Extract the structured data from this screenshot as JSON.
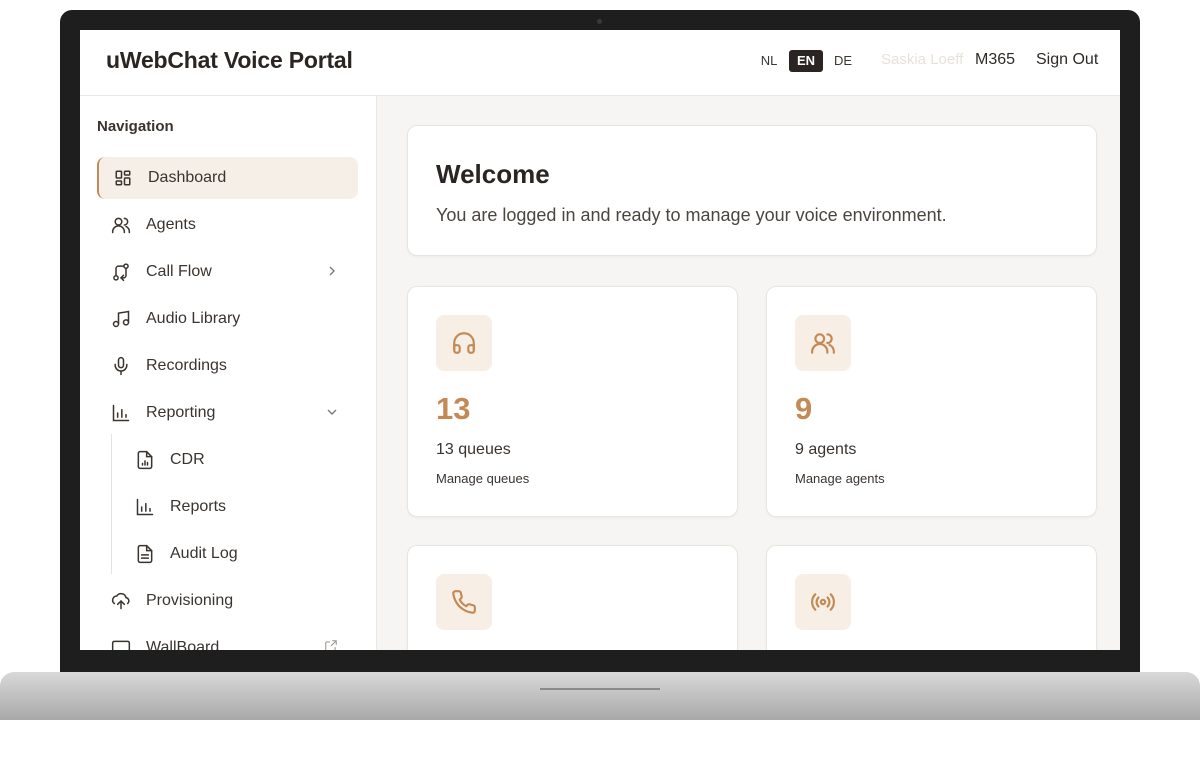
{
  "header": {
    "brand": "uWebChat Voice Portal",
    "languages": [
      "NL",
      "EN",
      "DE"
    ],
    "active_language": "EN",
    "user_name": "Saskia Loeff",
    "tenant": "M365",
    "sign_out": "Sign Out"
  },
  "sidebar": {
    "title": "Navigation",
    "items": [
      {
        "label": "Dashboard",
        "icon": "dashboard-icon",
        "active": true
      },
      {
        "label": "Agents",
        "icon": "users-icon"
      },
      {
        "label": "Call Flow",
        "icon": "flow-icon",
        "trail": "chevron-right-icon"
      },
      {
        "label": "Audio Library",
        "icon": "music-icon"
      },
      {
        "label": "Recordings",
        "icon": "mic-icon"
      },
      {
        "label": "Reporting",
        "icon": "bar-chart-icon",
        "trail": "chevron-down-icon",
        "expanded": true
      },
      {
        "label": "CDR",
        "icon": "file-chart-icon",
        "sub": true
      },
      {
        "label": "Reports",
        "icon": "bar-chart-icon",
        "sub": true
      },
      {
        "label": "Audit Log",
        "icon": "file-text-icon",
        "sub": true
      },
      {
        "label": "Provisioning",
        "icon": "cloud-upload-icon"
      },
      {
        "label": "WallBoard",
        "icon": "monitor-icon",
        "trail": "external-link-icon"
      }
    ]
  },
  "welcome": {
    "title": "Welcome",
    "text": "You are logged in and ready to manage your voice environment."
  },
  "stats": [
    {
      "icon": "headphones-icon",
      "value": "13",
      "label": "13 queues",
      "link": "Manage queues"
    },
    {
      "icon": "users-icon",
      "value": "9",
      "label": "9 agents",
      "link": "Manage agents"
    },
    {
      "icon": "phone-icon",
      "value": "",
      "label": "",
      "link": ""
    },
    {
      "icon": "radio-icon",
      "value": "",
      "label": "",
      "link": ""
    }
  ],
  "colors": {
    "accent": "#c48a55",
    "accent_bg": "#f7efe6",
    "text": "#2a2522",
    "surface": "#ffffff",
    "background": "#f7f5f3"
  }
}
